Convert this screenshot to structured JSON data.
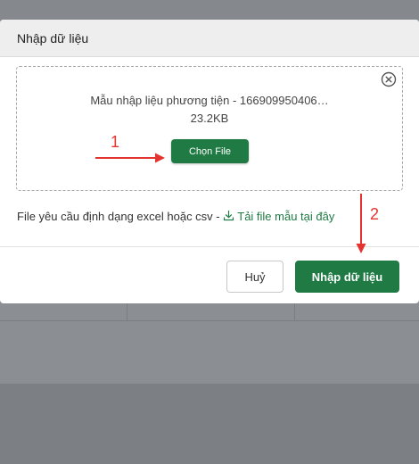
{
  "modal": {
    "title": "Nhập dữ liệu",
    "file_name": "Mẫu nhập liệu phương tiện - 166909950406…",
    "file_size": "23.2KB",
    "choose_file_label": "Chọn File",
    "hint_text": "File yêu cầu định dạng excel hoặc csv - ",
    "template_link_label": "Tải file mẫu tại đây",
    "cancel_label": "Huỷ",
    "import_label": "Nhập dữ liệu"
  },
  "annotations": {
    "step1": "1",
    "step2": "2"
  },
  "colors": {
    "primary": "#1f7a44",
    "annotation": "#e3342f",
    "backdrop": "#8a8e93"
  },
  "icons": [
    "close-circle-icon",
    "download-icon",
    "red-arrow-right",
    "red-arrow-down"
  ]
}
